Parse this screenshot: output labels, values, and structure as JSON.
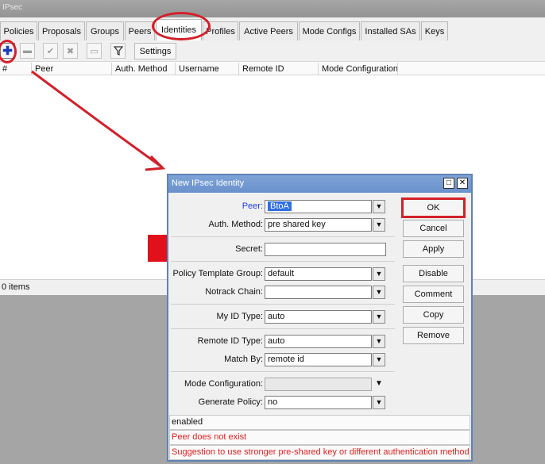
{
  "window": {
    "title": "IPsec",
    "tabs": [
      "Policies",
      "Proposals",
      "Groups",
      "Peers",
      "Identities",
      "Profiles",
      "Active Peers",
      "Mode Configs",
      "Installed SAs",
      "Keys"
    ],
    "active_tab": "Identities",
    "toolbar": {
      "add_icon": "plus-icon",
      "remove_icon": "minus-icon",
      "enable_icon": "check-icon",
      "disable_icon": "cross-icon",
      "comment_icon": "note-icon",
      "filter_icon": "funnel-icon",
      "settings_label": "Settings"
    },
    "columns": [
      "#",
      "Peer",
      "Auth. Method",
      "Username",
      "Remote ID",
      "Mode Configuration"
    ],
    "status": "0 items"
  },
  "dialog": {
    "title": "New IPsec Identity",
    "fields": {
      "peer": {
        "label": "Peer:",
        "value": "BtoA"
      },
      "auth_method": {
        "label": "Auth. Method:",
        "value": "pre shared key"
      },
      "secret": {
        "label": "Secret:",
        "value": ""
      },
      "policy_template_group": {
        "label": "Policy Template Group:",
        "value": "default"
      },
      "notrack_chain": {
        "label": "Notrack Chain:",
        "value": ""
      },
      "my_id_type": {
        "label": "My ID Type:",
        "value": "auto"
      },
      "remote_id_type": {
        "label": "Remote ID Type:",
        "value": "auto"
      },
      "match_by": {
        "label": "Match By:",
        "value": "remote id"
      },
      "mode_configuration": {
        "label": "Mode Configuration:",
        "value": ""
      },
      "generate_policy": {
        "label": "Generate Policy:",
        "value": "no"
      }
    },
    "buttons": {
      "ok": "OK",
      "cancel": "Cancel",
      "apply": "Apply",
      "disable": "Disable",
      "comment": "Comment",
      "copy": "Copy",
      "remove": "Remove"
    },
    "status": {
      "enabled": "enabled",
      "error": "Peer does not exist",
      "suggestion": "Suggestion to use stronger pre-shared key or different authentication method"
    }
  },
  "colors": {
    "annotation_red": "#d3202a",
    "dialog_title_blue": "#6a91cc",
    "error_text": "#e02020"
  }
}
